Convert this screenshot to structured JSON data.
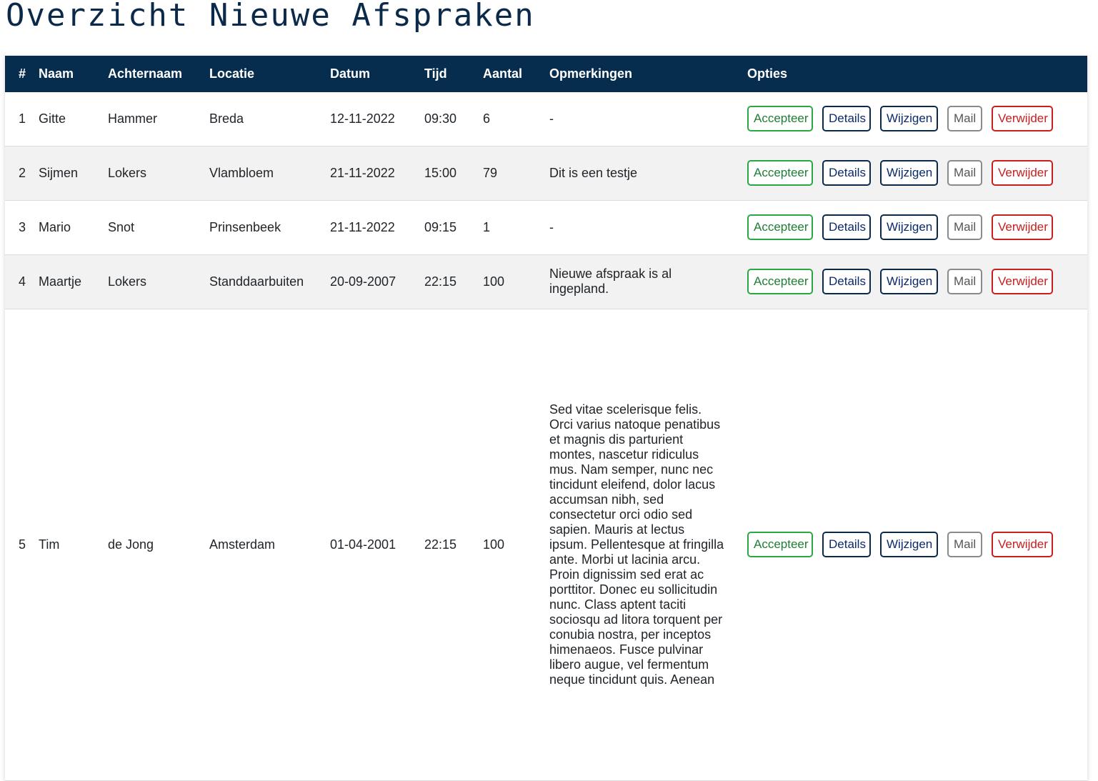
{
  "page": {
    "title": "Overzicht Nieuwe Afspraken"
  },
  "table": {
    "headers": [
      "#",
      "Naam",
      "Achternaam",
      "Locatie",
      "Datum",
      "Tijd",
      "Aantal",
      "Opmerkingen",
      "Opties"
    ],
    "buttons": {
      "accept": "Accepteer",
      "details": "Details",
      "edit": "Wijzigen",
      "mail": "Mail",
      "delete": "Verwijder"
    },
    "rows": [
      {
        "num": "1",
        "naam": "Gitte",
        "achternaam": "Hammer",
        "locatie": "Breda",
        "datum": "12-11-2022",
        "tijd": "09:30",
        "aantal": "6",
        "opmerkingen": "-"
      },
      {
        "num": "2",
        "naam": "Sijmen",
        "achternaam": "Lokers",
        "locatie": "Vlambloem",
        "datum": "21-11-2022",
        "tijd": "15:00",
        "aantal": "79",
        "opmerkingen": "Dit is een testje"
      },
      {
        "num": "3",
        "naam": "Mario",
        "achternaam": "Snot",
        "locatie": "Prinsenbeek",
        "datum": "21-11-2022",
        "tijd": "09:15",
        "aantal": "1",
        "opmerkingen": "-"
      },
      {
        "num": "4",
        "naam": "Maartje",
        "achternaam": "Lokers",
        "locatie": "Standdaarbuiten",
        "datum": "20-09-2007",
        "tijd": "22:15",
        "aantal": "100",
        "opmerkingen": "Nieuwe afspraak is al ingepland."
      },
      {
        "num": "5",
        "naam": "Tim",
        "achternaam": "de Jong",
        "locatie": "Amsterdam",
        "datum": "01-04-2001",
        "tijd": "22:15",
        "aantal": "100",
        "opmerkingen": "Sed vitae scelerisque felis. Orci varius natoque penatibus et magnis dis parturient montes, nascetur ridiculus mus. Nam semper, nunc nec tincidunt eleifend, dolor lacus accumsan nibh, sed consectetur orci odio sed sapien. Mauris at lectus ipsum. Pellentesque at fringilla ante. Morbi ut lacinia arcu. Proin dignissim sed erat ac porttitor. Donec eu sollicitudin nunc. Class aptent taciti sociosqu ad litora torquent per conubia nostra, per inceptos himenaeos. Fusce pulvinar libero augue, vel fermentum neque tincidunt quis. Aenean"
      }
    ]
  }
}
